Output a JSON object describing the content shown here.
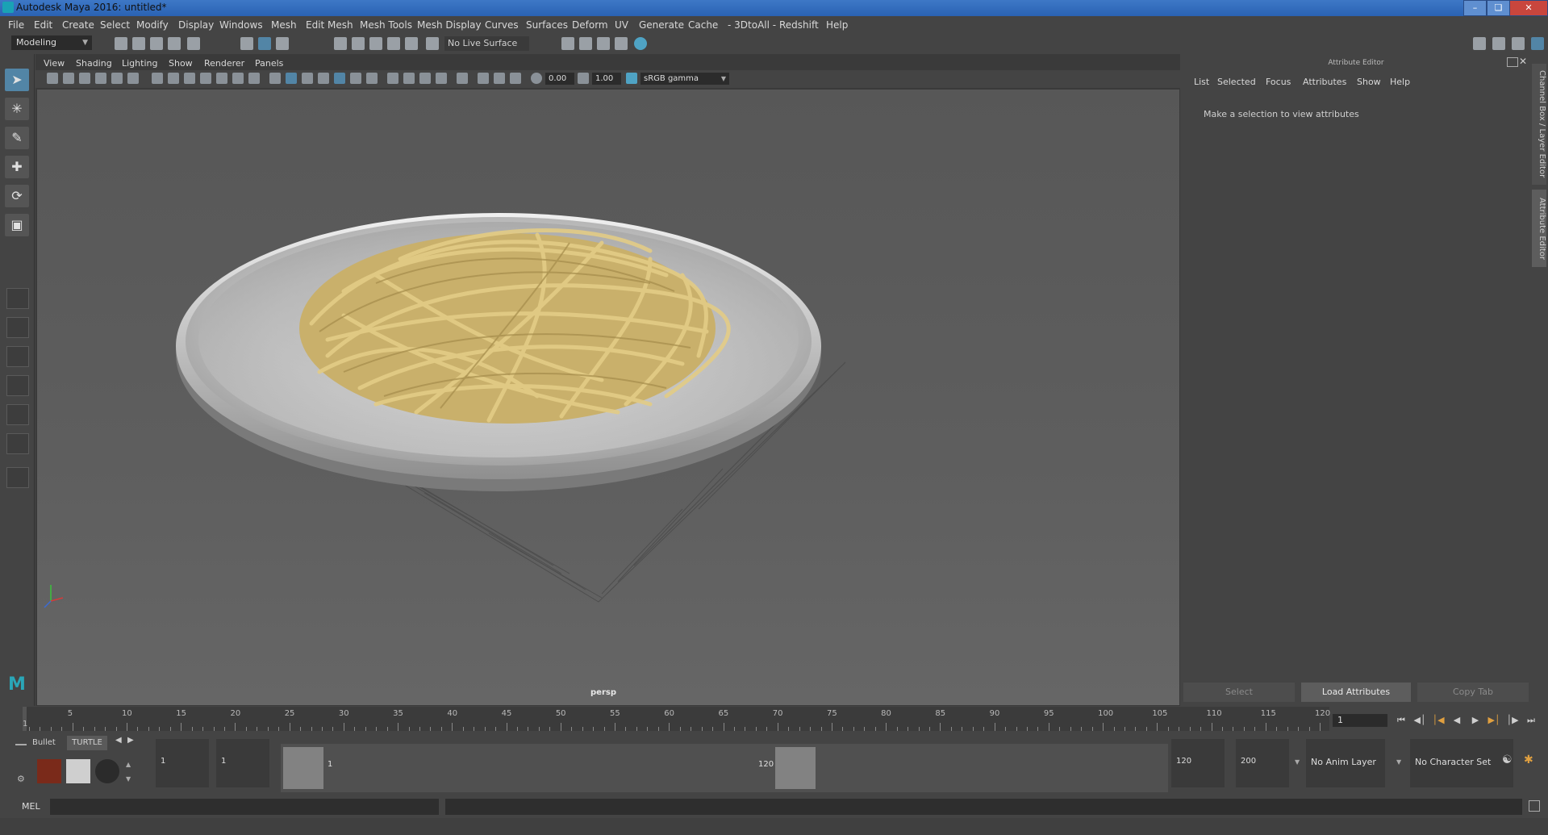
{
  "window": {
    "title": "Autodesk Maya 2016: untitled*"
  },
  "menubar": {
    "items": [
      "File",
      "Edit",
      "Create",
      "Select",
      "Modify",
      "Display",
      "Windows",
      "Mesh",
      "Edit Mesh",
      "Mesh Tools",
      "Mesh Display",
      "Curves",
      "Surfaces",
      "Deform",
      "UV",
      "Generate",
      "Cache",
      "- 3DtoAll -",
      "Redshift",
      "Help"
    ]
  },
  "statusline": {
    "mode": "Modeling",
    "live_surface": "No Live Surface"
  },
  "viewport": {
    "menu": [
      "View",
      "Shading",
      "Lighting",
      "Show",
      "Renderer",
      "Panels"
    ],
    "exposure": "0.00",
    "gamma": "1.00",
    "color_space": "sRGB gamma",
    "camera_label": "persp"
  },
  "attribute_editor": {
    "header": "Attribute Editor",
    "menu": [
      "List",
      "Selected",
      "Focus",
      "Attributes",
      "Show",
      "Help"
    ],
    "message": "Make a selection to view attributes",
    "buttons": {
      "select": "Select",
      "load": "Load Attributes",
      "copy": "Copy Tab"
    },
    "side_tabs": [
      "Channel Box / Layer Editor",
      "Attribute Editor"
    ]
  },
  "timeslider": {
    "ticks": [
      "5",
      "10",
      "15",
      "20",
      "25",
      "30",
      "35",
      "40",
      "45",
      "50",
      "55",
      "60",
      "65",
      "70",
      "75",
      "80",
      "85",
      "90",
      "95",
      "100",
      "105",
      "110",
      "115",
      "120"
    ],
    "start_marker": "1",
    "current_frame": "1"
  },
  "range": {
    "shelf_tabs": [
      "Bullet",
      "TURTLE"
    ],
    "start": "1",
    "playback_start": "1",
    "range_start_label": "1",
    "range_end_label": "120",
    "playback_end": "120",
    "end": "200",
    "anim_layer": "No Anim Layer",
    "character_set": "No Character Set"
  },
  "commandline": {
    "label": "MEL"
  }
}
